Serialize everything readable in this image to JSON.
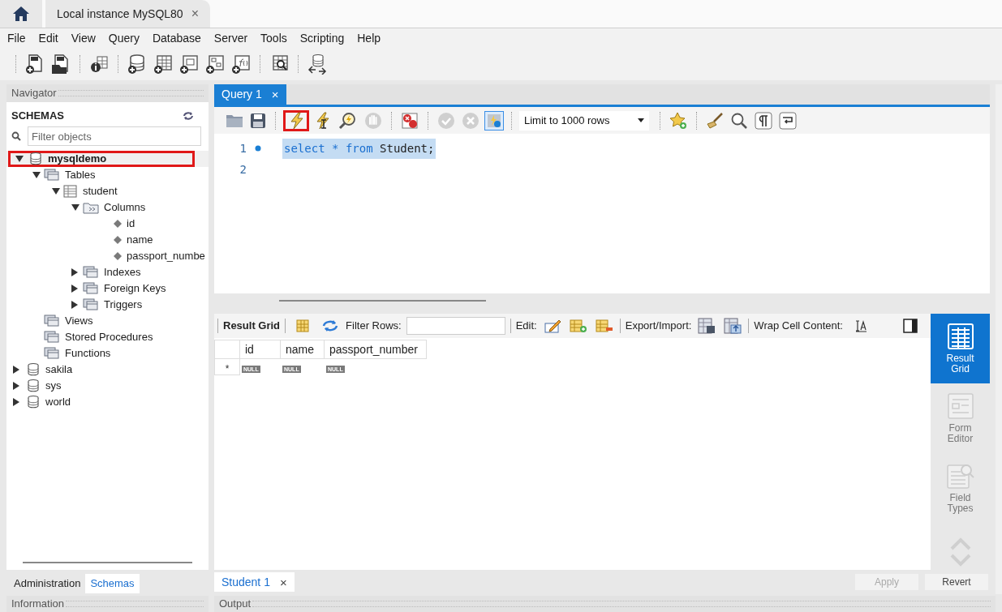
{
  "window_tab": {
    "title": "Local instance MySQL80",
    "close": "×"
  },
  "menu": [
    "File",
    "Edit",
    "View",
    "Query",
    "Database",
    "Server",
    "Tools",
    "Scripting",
    "Help"
  ],
  "navigator": {
    "title": "Navigator",
    "section": "SCHEMAS",
    "filter_placeholder": "Filter objects",
    "tree": [
      {
        "label": "mysqldemo",
        "kind": "database",
        "expanded": true,
        "selected": true,
        "highlighted": true,
        "children": [
          {
            "label": "Tables",
            "kind": "folder",
            "expanded": true,
            "selected": false,
            "children": [
              {
                "label": "student",
                "kind": "table",
                "expanded": true,
                "selected": false,
                "children": [
                  {
                    "label": "Columns",
                    "kind": "columns",
                    "expanded": true,
                    "selected": false,
                    "children": [
                      {
                        "label": "id",
                        "kind": "column",
                        "selected": false
                      },
                      {
                        "label": "name",
                        "kind": "column",
                        "selected": false
                      },
                      {
                        "label": "passport_numbe",
                        "kind": "column",
                        "selected": false
                      }
                    ]
                  },
                  {
                    "label": "Indexes",
                    "kind": "folder",
                    "expanded": false,
                    "selected": false
                  },
                  {
                    "label": "Foreign Keys",
                    "kind": "folder",
                    "expanded": false,
                    "selected": false
                  },
                  {
                    "label": "Triggers",
                    "kind": "folder",
                    "expanded": false,
                    "selected": false
                  }
                ]
              }
            ]
          },
          {
            "label": "Views",
            "kind": "folder",
            "selected": false
          },
          {
            "label": "Stored Procedures",
            "kind": "folder",
            "selected": false
          },
          {
            "label": "Functions",
            "kind": "folder",
            "selected": false
          }
        ]
      },
      {
        "label": "sakila",
        "kind": "database",
        "expanded": false,
        "selected": false
      },
      {
        "label": "sys",
        "kind": "database",
        "expanded": false,
        "selected": false
      },
      {
        "label": "world",
        "kind": "database",
        "expanded": false,
        "selected": false
      }
    ],
    "bottom_tabs": [
      {
        "label": "Administration",
        "selected": false
      },
      {
        "label": "Schemas",
        "selected": true
      }
    ]
  },
  "query_tabs": [
    {
      "label": "Query 1",
      "close": "×",
      "selected": true
    }
  ],
  "editor_toolbar": {
    "execute_highlighted": true,
    "limit": "Limit to 1000 rows"
  },
  "editor_lines": [
    {
      "number": "1",
      "marker": true,
      "selected": true,
      "tokens": [
        {
          "text": "select",
          "kind": "keyword"
        },
        {
          "text": "*",
          "kind": "keyword"
        },
        {
          "text": "from",
          "kind": "keyword"
        },
        {
          "text": "Student;",
          "kind": "identifier"
        }
      ]
    },
    {
      "number": "2",
      "selected": false
    }
  ],
  "result_toolbar": {
    "title": "Result Grid",
    "filter_label": "Filter Rows:",
    "edit_label": "Edit:",
    "export_label": "Export/Import:",
    "wrap_label": "Wrap Cell Content:"
  },
  "grid": {
    "columns": [
      "id",
      "name",
      "passport_number"
    ],
    "new_row_marker": "*",
    "new_row": [
      "NULL",
      "NULL",
      "NULL"
    ]
  },
  "side_panel": [
    {
      "label": "Result Grid",
      "kind": "grid",
      "selected": true
    },
    {
      "label": "Form Editor",
      "kind": "form",
      "selected": false
    },
    {
      "label": "Field Types",
      "kind": "types",
      "selected": false
    }
  ],
  "result_tabs": [
    {
      "label": "Student 1",
      "close": "×",
      "selected": true
    }
  ],
  "result_buttons": [
    {
      "label": "Apply",
      "disabled": true
    },
    {
      "label": "Revert",
      "disabled": false
    }
  ],
  "bottom_panels": {
    "left": "Information",
    "right": "Output"
  }
}
